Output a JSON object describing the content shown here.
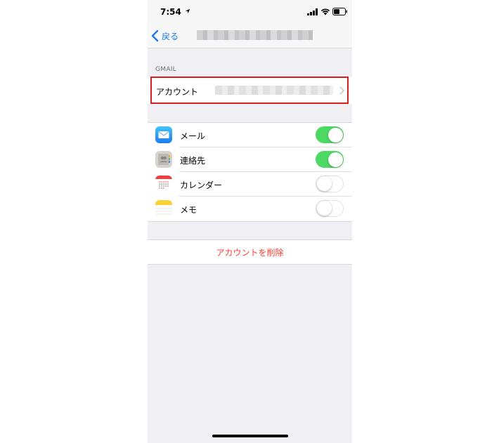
{
  "status_bar": {
    "time": "7:54"
  },
  "nav": {
    "back_label": "戻る"
  },
  "section": {
    "header": "GMAIL",
    "account_label": "アカウント"
  },
  "services": [
    {
      "label": "メール",
      "icon": "mail-icon",
      "enabled": true
    },
    {
      "label": "連絡先",
      "icon": "contacts-icon",
      "enabled": true
    },
    {
      "label": "カレンダー",
      "icon": "calendar-icon",
      "enabled": false
    },
    {
      "label": "メモ",
      "icon": "notes-icon",
      "enabled": false
    }
  ],
  "delete": {
    "label": "アカウントを削除"
  },
  "colors": {
    "accent": "#1a7cf0",
    "toggle_on": "#4cd964",
    "destructive": "#ff3b30",
    "highlight": "#d81e1e"
  }
}
